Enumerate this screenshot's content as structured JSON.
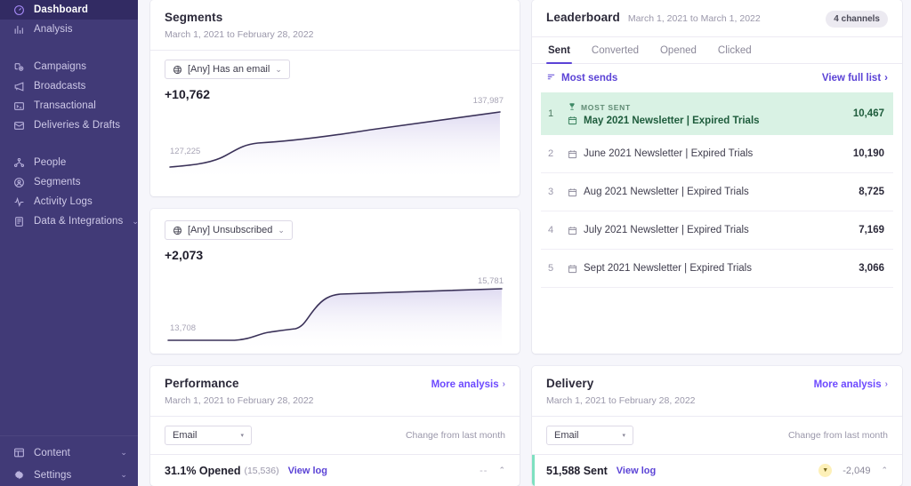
{
  "sidebar": {
    "groups": [
      {
        "items": [
          {
            "label": "Dashboard",
            "icon": "dashboard-icon",
            "active": true
          },
          {
            "label": "Analysis",
            "icon": "analysis-bar-chart-icon",
            "active": false
          }
        ]
      },
      {
        "items": [
          {
            "label": "Campaigns",
            "icon": "campaigns-icon",
            "active": false
          },
          {
            "label": "Broadcasts",
            "icon": "megaphone-icon",
            "active": false
          },
          {
            "label": "Transactional",
            "icon": "terminal-icon",
            "active": false
          },
          {
            "label": "Deliveries & Drafts",
            "icon": "deliveries-icon",
            "active": false
          }
        ]
      },
      {
        "items": [
          {
            "label": "People",
            "icon": "people-icon",
            "active": false
          },
          {
            "label": "Segments",
            "icon": "segments-user-circle-icon",
            "active": false
          },
          {
            "label": "Activity Logs",
            "icon": "activity-pulse-icon",
            "active": false
          },
          {
            "label": "Data & Integrations",
            "icon": "database-icon",
            "active": false,
            "chevron": "⌄"
          }
        ]
      }
    ],
    "bottom": [
      {
        "label": "Content",
        "icon": "content-layout-icon",
        "chevron": "⌄"
      },
      {
        "label": "Settings",
        "icon": "gear-icon",
        "chevron": "⌄"
      }
    ]
  },
  "segments": {
    "title": "Segments",
    "daterange": "March 1, 2021 to February 28, 2022",
    "blocks": [
      {
        "chip_label": "[Any] Has an email",
        "chip_caret": "⌄",
        "value": "+10,762",
        "start_label": "127,225",
        "end_label": "137,987"
      },
      {
        "chip_label": "[Any] Unsubscribed",
        "chip_caret": "⌄",
        "value": "+2,073",
        "start_label": "13,708",
        "end_label": "15,781"
      }
    ]
  },
  "leaderboard": {
    "title": "Leaderboard",
    "daterange": "March 1, 2021 to March 1, 2022",
    "badge": "4 channels",
    "tabs": [
      {
        "label": "Sent",
        "active": true
      },
      {
        "label": "Converted",
        "active": false
      },
      {
        "label": "Opened",
        "active": false
      },
      {
        "label": "Clicked",
        "active": false
      }
    ],
    "sort_label": "Most sends",
    "view_full_list": "View full list",
    "view_chevron": "›",
    "top_tag": "MOST SENT",
    "rows": [
      {
        "rank": "1",
        "name": "May 2021 Newsletter | Expired Trials",
        "value": "10,467"
      },
      {
        "rank": "2",
        "name": "June 2021 Newsletter | Expired Trials",
        "value": "10,190"
      },
      {
        "rank": "3",
        "name": "Aug 2021 Newsletter | Expired Trials",
        "value": "8,725"
      },
      {
        "rank": "4",
        "name": "July 2021 Newsletter | Expired Trials",
        "value": "7,169"
      },
      {
        "rank": "5",
        "name": "Sept 2021 Newsletter | Expired Trials",
        "value": "3,066"
      }
    ]
  },
  "performance": {
    "title": "Performance",
    "daterange": "March 1, 2021 to February 28, 2022",
    "more_label": "More analysis",
    "more_chevron": "›",
    "channel": "Email",
    "channel_caret": "▾",
    "change_label": "Change from last month",
    "metric_main": "31.1% Opened",
    "metric_count": "(15,536)",
    "metric_link": "View log",
    "metric_delta": "--",
    "metric_caret": "⌃"
  },
  "delivery": {
    "title": "Delivery",
    "daterange": "March 1, 2021 to February 28, 2022",
    "more_label": "More analysis",
    "more_chevron": "›",
    "channel": "Email",
    "channel_caret": "▾",
    "change_label": "Change from last month",
    "metric_main": "51,588 Sent",
    "metric_link": "View log",
    "metric_delta": "-2,049",
    "metric_delta_dir": "▼",
    "metric_caret": "⌃"
  },
  "chart_data": [
    {
      "type": "area",
      "title": "[Any] Has an email",
      "xlabel": "",
      "ylabel": "",
      "x": [
        0,
        1,
        2,
        3,
        4,
        5,
        6,
        7,
        8,
        9,
        10,
        11,
        12
      ],
      "values": [
        127225,
        127500,
        128100,
        129900,
        130600,
        131100,
        131700,
        132400,
        133200,
        134100,
        135200,
        136500,
        137987
      ],
      "tick_labels": [
        "127,225",
        "137,987"
      ],
      "ylim": [
        126500,
        138600
      ],
      "grid": false,
      "legend": "none",
      "line_color": "#3a3158",
      "fill_color": "#eceaf7"
    },
    {
      "type": "area",
      "title": "[Any] Unsubscribed",
      "xlabel": "",
      "ylabel": "",
      "x": [
        0,
        1,
        2,
        3,
        4,
        5,
        6,
        7,
        8,
        9,
        10,
        11,
        12
      ],
      "values": [
        13708,
        13710,
        13715,
        13760,
        13900,
        13960,
        14000,
        14250,
        15300,
        15580,
        15640,
        15700,
        15781
      ],
      "tick_labels": [
        "13,708",
        "15,781"
      ],
      "ylim": [
        13600,
        16000
      ],
      "grid": false,
      "legend": "none",
      "line_color": "#3a3158",
      "fill_color": "#eceaf7"
    }
  ]
}
